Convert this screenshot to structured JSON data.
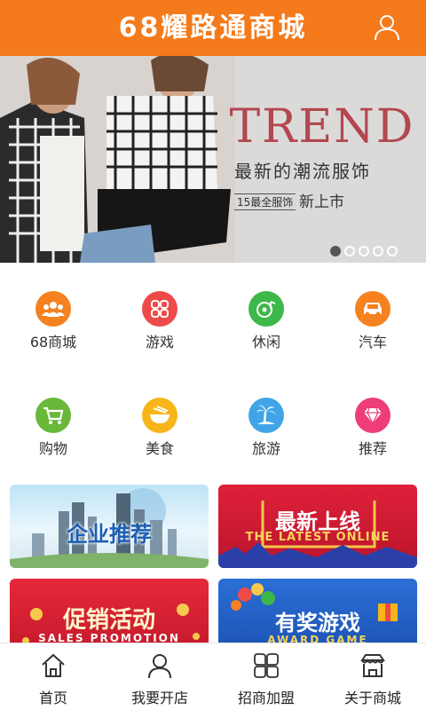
{
  "header": {
    "title": "68耀路通商城",
    "user_icon": "user-icon"
  },
  "banner": {
    "headline": "TREND",
    "subtitle": "最新的潮流服饰",
    "tag_small": "15最全服饰",
    "tag_big": "新上市",
    "slides_total": 5,
    "active_slide": 1
  },
  "categories": [
    {
      "label": "68商城",
      "icon": "group-icon",
      "color": "#f5811f"
    },
    {
      "label": "游戏",
      "icon": "grid-icon",
      "color": "#ef4a4a"
    },
    {
      "label": "休闲",
      "icon": "music-icon",
      "color": "#3db84a"
    },
    {
      "label": "汽车",
      "icon": "car-icon",
      "color": "#f5811f"
    },
    {
      "label": "购物",
      "icon": "cart-icon",
      "color": "#69b83a"
    },
    {
      "label": "美食",
      "icon": "bowl-icon",
      "color": "#f7b51a"
    },
    {
      "label": "旅游",
      "icon": "palm-icon",
      "color": "#41a4e6"
    },
    {
      "label": "推荐",
      "icon": "diamond-icon",
      "color": "#ee3d78"
    }
  ],
  "tiles": [
    {
      "title": "企业推荐",
      "subtitle": ""
    },
    {
      "title": "最新上线",
      "subtitle": "THE LATEST ONLINE"
    },
    {
      "title": "促销活动",
      "subtitle": "SALES PROMOTION"
    },
    {
      "title": "有奖游戏",
      "subtitle": "AWARD GAME"
    }
  ],
  "tabbar": [
    {
      "label": "首页",
      "icon": "home-icon"
    },
    {
      "label": "我要开店",
      "icon": "person-icon"
    },
    {
      "label": "招商加盟",
      "icon": "clover-icon"
    },
    {
      "label": "关于商城",
      "icon": "store-icon"
    }
  ],
  "colors": {
    "header": "#f47a1c",
    "trend": "#b2474f"
  }
}
